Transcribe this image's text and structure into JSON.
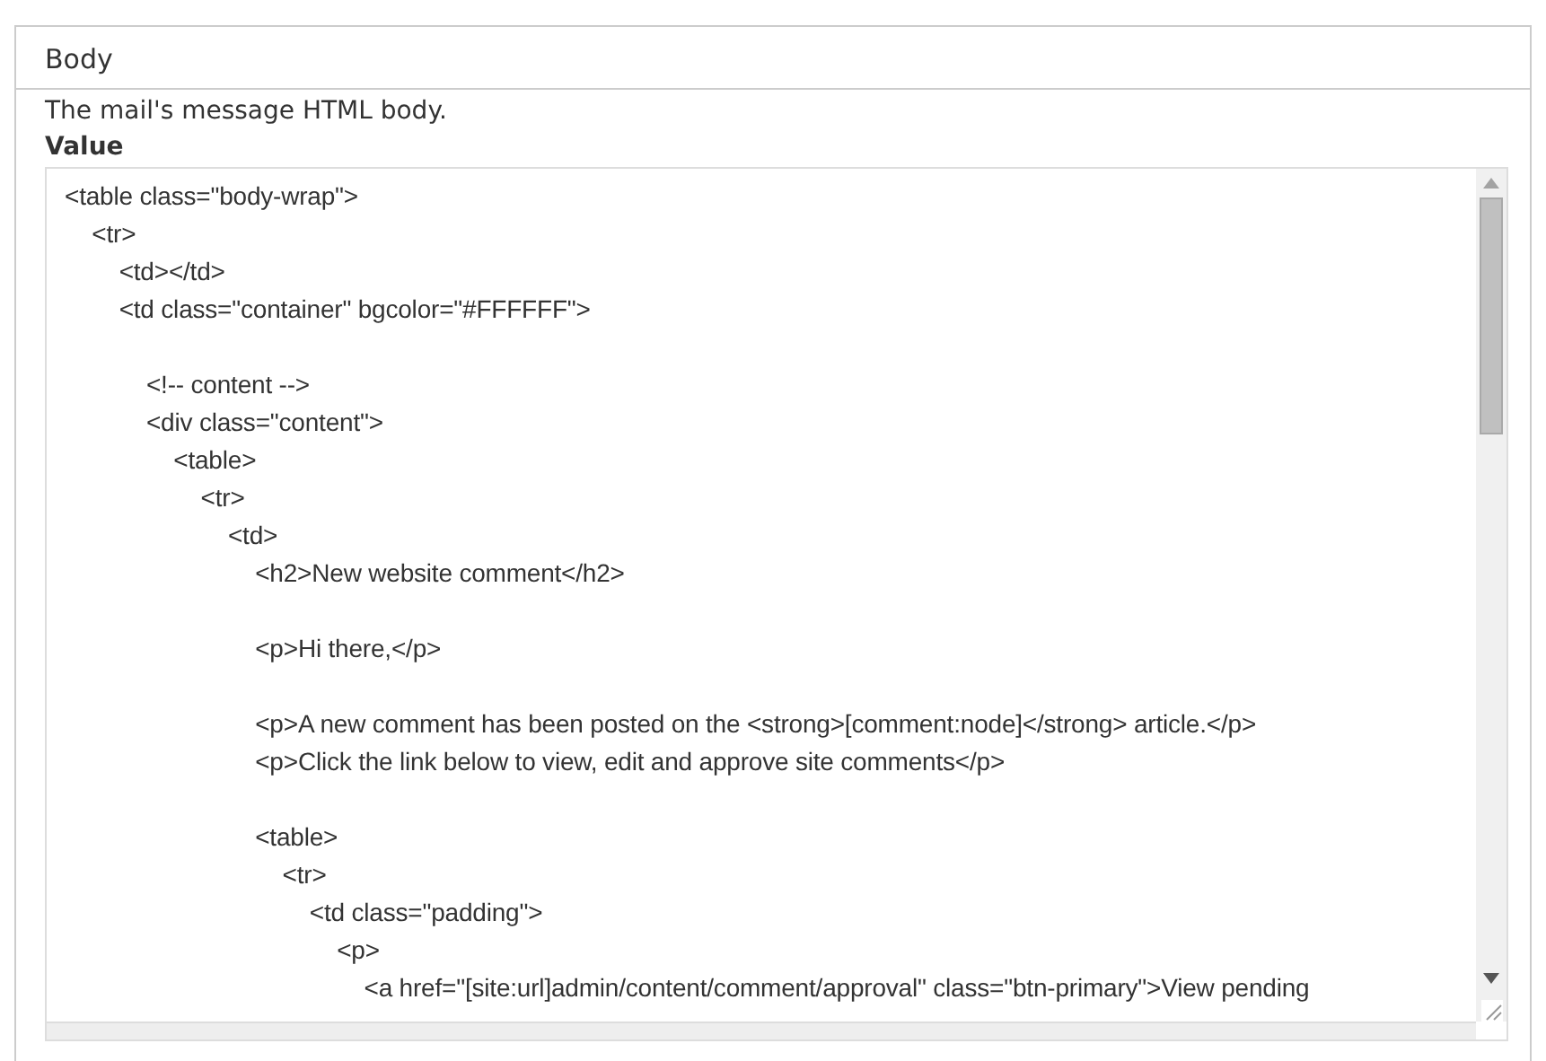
{
  "panel": {
    "title": "Body",
    "description": "The mail's message HTML body.",
    "field_label": "Value",
    "value": "<table class=\"body-wrap\">\n    <tr>\n        <td></td>\n        <td class=\"container\" bgcolor=\"#FFFFFF\">\n\n            <!-- content -->\n            <div class=\"content\">\n                <table>\n                    <tr>\n                        <td>\n                            <h2>New website comment</h2>\n\n                            <p>Hi there,</p>\n\n                            <p>A new comment has been posted on the <strong>[comment:node]</strong> article.</p>\n                            <p>Click the link below to view, edit and approve site comments</p>\n\n                            <table>\n                                <tr>\n                                    <td class=\"padding\">\n                                        <p>\n                                            <a href=\"[site:url]admin/content/comment/approval\" class=\"btn-primary\">View pending"
  }
}
